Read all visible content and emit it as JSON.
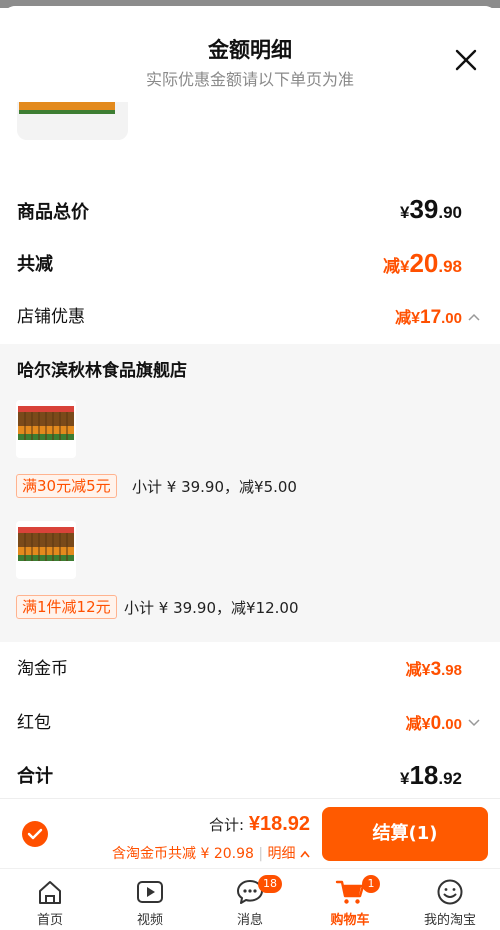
{
  "header": {
    "title": "金额明细",
    "subtitle": "实际优惠金额请以下单页为准"
  },
  "summary": {
    "goods_total_label": "商品总价",
    "goods_total_currency": "¥",
    "goods_total_int": "39",
    "goods_total_dec": ".90",
    "total_discount_label": "共减",
    "total_discount_prefix": "减¥",
    "total_discount_int": "20",
    "total_discount_dec": ".98",
    "shop_discount_label": "店铺优惠",
    "shop_discount_prefix": "减¥",
    "shop_discount_int": "17",
    "shop_discount_dec": ".00"
  },
  "shop": {
    "name": "哈尔滨秋林食品旗舰店",
    "items": [
      {
        "promo_tag": "满30元减5元",
        "promo_text": "小计 ¥ 39.90，减¥5.00"
      },
      {
        "promo_tag": "满1件减12元",
        "promo_text": "小计 ¥ 39.90，减¥12.00"
      }
    ]
  },
  "extras": {
    "coin_label": "淘金币",
    "coin_prefix": "减¥",
    "coin_int": "3",
    "coin_dec": ".98",
    "redpacket_label": "红包",
    "redpacket_prefix": "减¥",
    "redpacket_int": "0",
    "redpacket_dec": ".00",
    "total_label": "合计",
    "total_currency": "¥",
    "total_int": "18",
    "total_dec": ".92"
  },
  "footer": {
    "total_label": "合计: ",
    "total_amount": "¥18.92",
    "coin_text": "含淘金币共减 ¥ 20.98",
    "detail_link": "明细",
    "checkout_label": "结算(1)"
  },
  "tabbar": {
    "items": [
      {
        "label": "首页",
        "icon": "home-icon"
      },
      {
        "label": "视频",
        "icon": "video-icon"
      },
      {
        "label": "消息",
        "icon": "message-icon",
        "badge": "18"
      },
      {
        "label": "购物车",
        "icon": "cart-icon",
        "badge": "1",
        "active": true
      },
      {
        "label": "我的淘宝",
        "icon": "profile-icon"
      }
    ]
  },
  "colors": {
    "accent": "#ff5000",
    "checkout_button": "#ff5a00"
  }
}
